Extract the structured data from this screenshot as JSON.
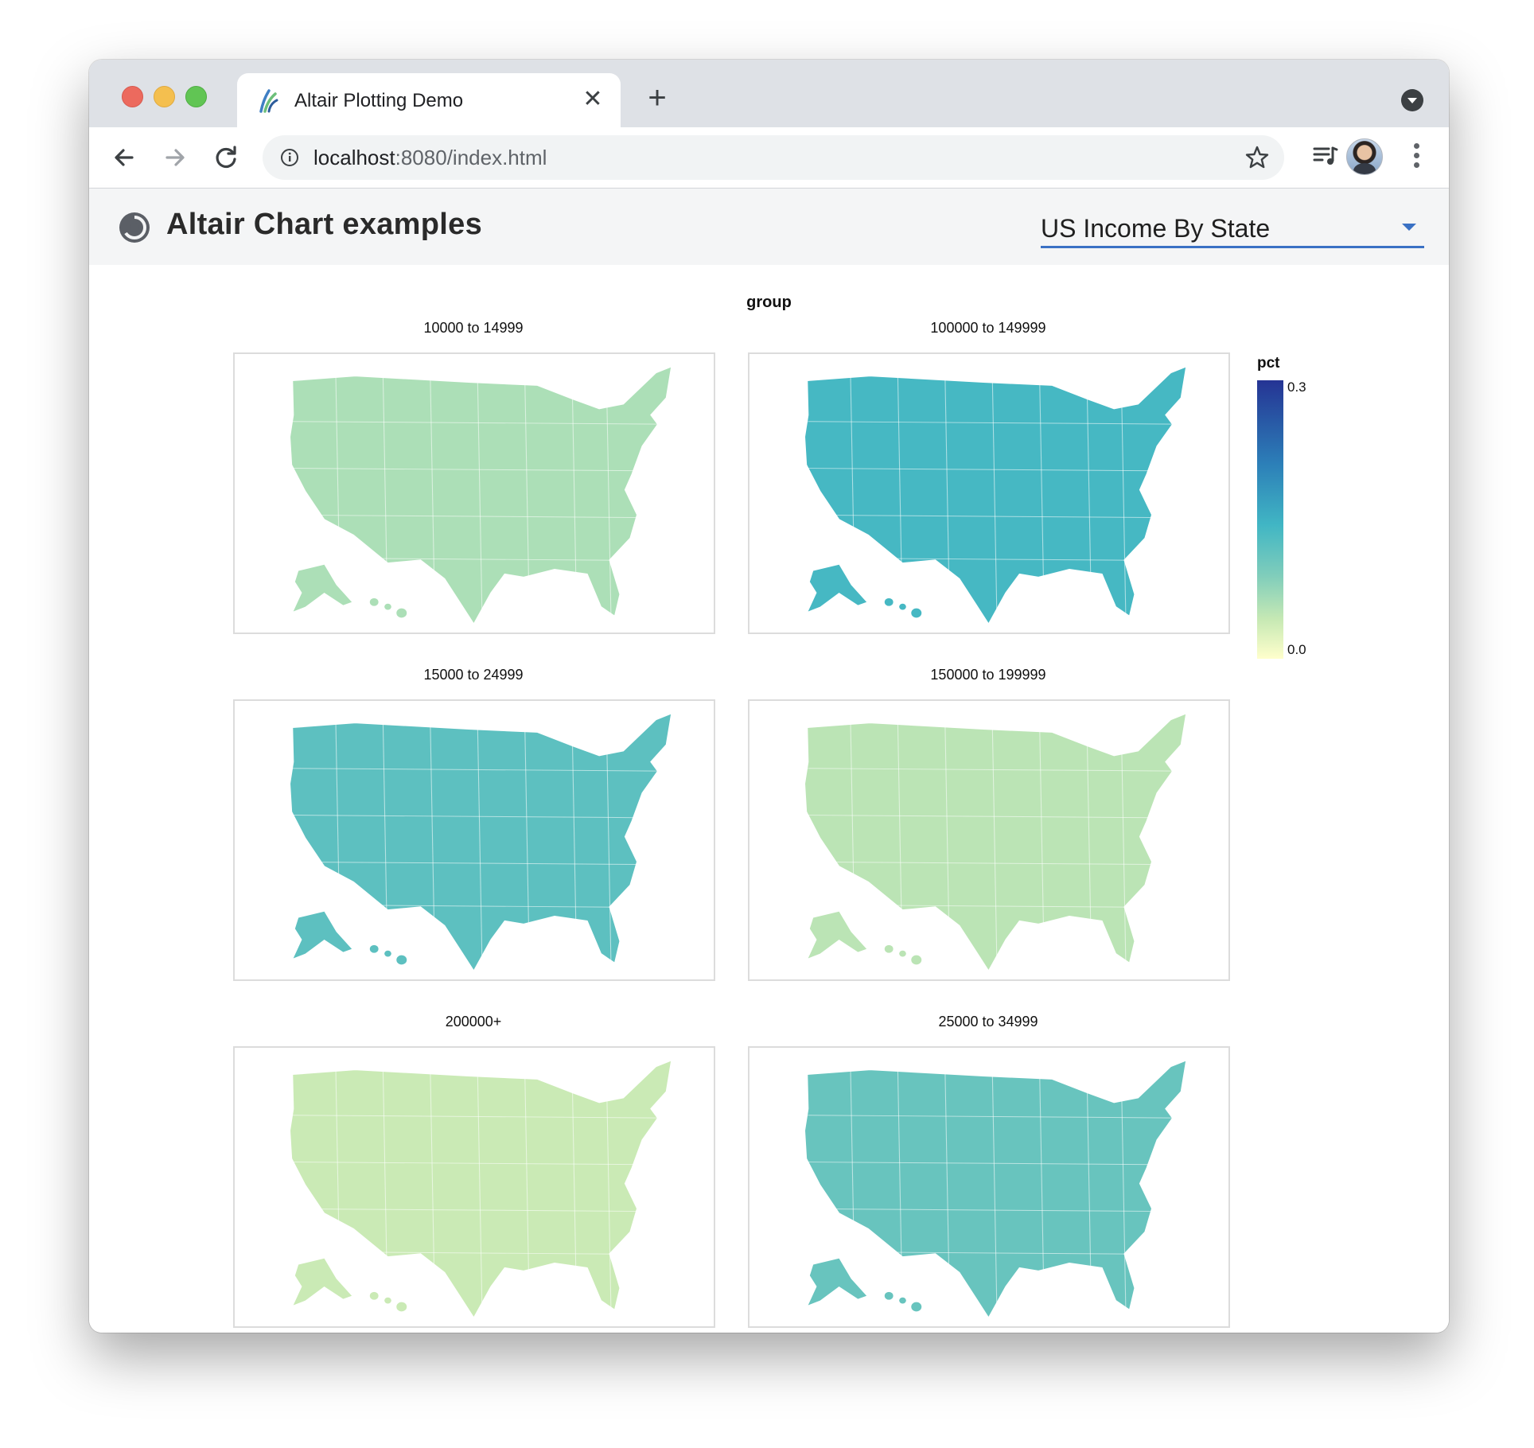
{
  "browser": {
    "tab_title": "Altair Plotting Demo",
    "url_host": "localhost",
    "url_path": ":8080/index.html"
  },
  "app": {
    "title": "Altair Chart examples",
    "dataset_select": {
      "value": "US Income By State"
    }
  },
  "chart_data": {
    "type": "choropleth",
    "facet_title": "group",
    "color_field": "pct",
    "color_scale": {
      "domain": [
        0.0,
        0.3
      ],
      "scheme": "yellowgreenblue",
      "legend_labels": [
        "0.3",
        "0.0"
      ]
    },
    "panels": [
      {
        "title": "10000 to 14999",
        "level": 0.06
      },
      {
        "title": "100000 to 149999",
        "level": 0.14
      },
      {
        "title": "15000 to 24999",
        "level": 0.12
      },
      {
        "title": "150000 to 199999",
        "level": 0.05
      },
      {
        "title": "200000+",
        "level": 0.04
      },
      {
        "title": "25000 to 34999",
        "level": 0.11
      }
    ]
  }
}
